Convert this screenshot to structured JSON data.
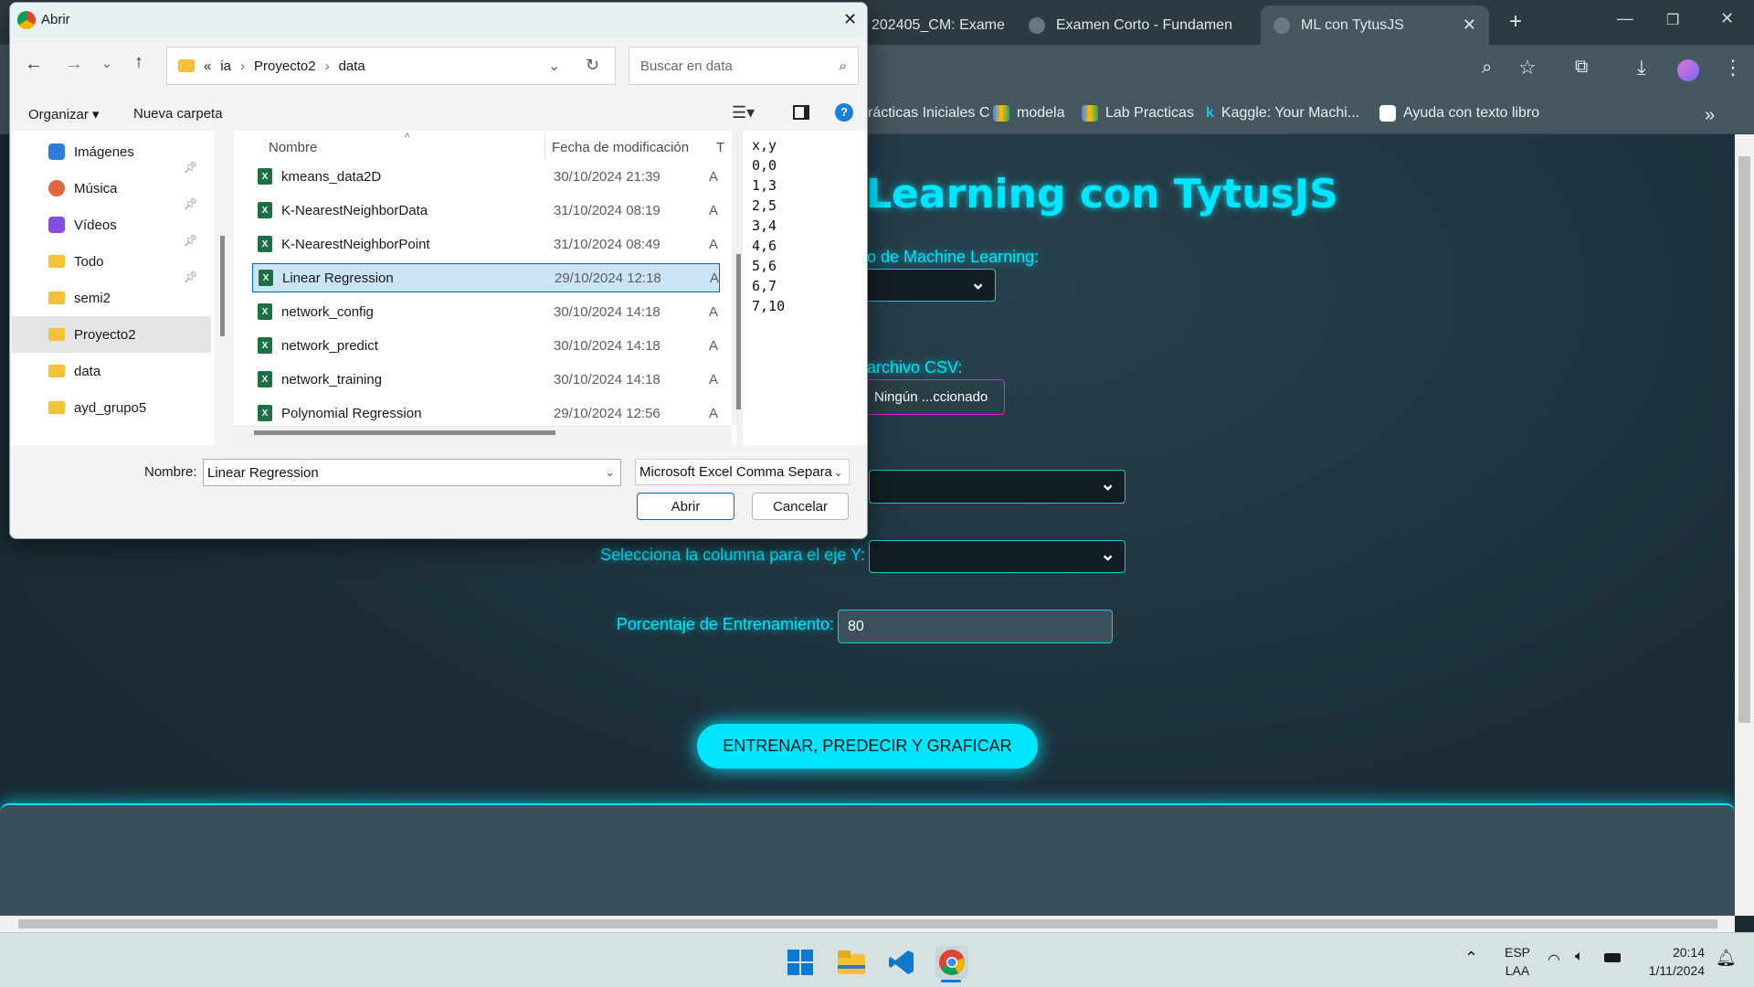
{
  "browser": {
    "tabs": [
      {
        "title": "202405_CM: Exame"
      },
      {
        "title": "Examen Corto - Fundamen"
      },
      {
        "title": "ML con TytusJS",
        "active": true
      }
    ],
    "new_tab": "+",
    "bookmarks": [
      "rácticas Iniciales C",
      "modela",
      "Lab Practicas",
      "Kaggle: Your Machi...",
      "Ayuda con texto libro"
    ],
    "more": "»"
  },
  "page": {
    "title": "Learning con TytusJS",
    "model_label": "o de Machine Learning:",
    "csv_label": "archivo CSV:",
    "file_button": "Ningún ...ccionado",
    "y_label": "Selecciona la columna para el eje Y:",
    "train_label": "Porcentaje de Entrenamiento:",
    "train_value": "80",
    "action_button": "ENTRENAR, PREDECIR Y GRAFICAR",
    "accent": "#00e5ff"
  },
  "dialog": {
    "title": "Abrir",
    "close": "✕",
    "breadcrumb": {
      "prefix": "«",
      "parts": [
        "ia",
        "Proyecto2",
        "data"
      ]
    },
    "search_placeholder": "Buscar en data",
    "organize": "Organizar ▾",
    "new_folder": "Nueva carpeta",
    "nav": [
      {
        "label": "Imágenes"
      },
      {
        "label": "Música"
      },
      {
        "label": "Vídeos"
      },
      {
        "label": "Todo"
      },
      {
        "label": "semi2"
      },
      {
        "label": "Proyecto2"
      },
      {
        "label": "data"
      },
      {
        "label": "ayd_grupo5"
      }
    ],
    "columns": {
      "name": "Nombre",
      "date": "Fecha de modificación",
      "type": "T"
    },
    "files": [
      {
        "name": "kmeans_data2D",
        "date": "30/10/2024 21:39",
        "type": "A"
      },
      {
        "name": "K-NearestNeighborData",
        "date": "31/10/2024 08:19",
        "type": "A"
      },
      {
        "name": "K-NearestNeighborPoint",
        "date": "31/10/2024 08:49",
        "type": "A"
      },
      {
        "name": "Linear Regression",
        "date": "29/10/2024 12:18",
        "type": "A"
      },
      {
        "name": "network_config",
        "date": "30/10/2024 14:18",
        "type": "A"
      },
      {
        "name": "network_predict",
        "date": "30/10/2024 14:18",
        "type": "A"
      },
      {
        "name": "network_training",
        "date": "30/10/2024 14:18",
        "type": "A"
      },
      {
        "name": "Polynomial Regression",
        "date": "29/10/2024 12:56",
        "type": "A"
      }
    ],
    "preview": [
      "x,y",
      "0,0",
      "1,3",
      "2,5",
      "3,4",
      "4,6",
      "5,6",
      "6,7",
      "7,10"
    ],
    "filename_label": "Nombre:",
    "filename": "Linear Regression",
    "filter": "Microsoft Excel Comma Separa",
    "open": "Abrir",
    "cancel": "Cancelar"
  },
  "taskbar": {
    "lang1": "ESP",
    "lang2": "LAA",
    "time": "20:14",
    "date": "1/11/2024"
  }
}
